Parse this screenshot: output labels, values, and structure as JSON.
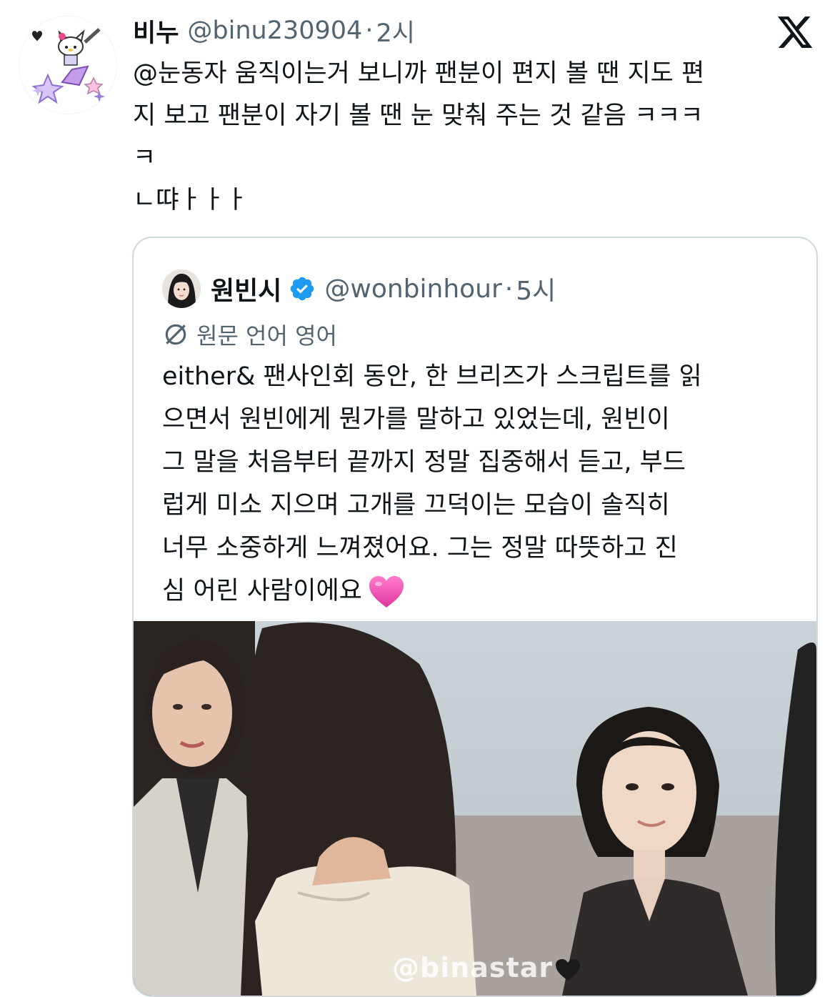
{
  "tweet": {
    "display_name": "비누",
    "handle": "@binu230904",
    "separator": "·",
    "time": "2시",
    "text_lines": [
      "@눈동자 움직이는거 보니까 팬분이 편지 볼 땐 지도 편",
      "지 보고 팬분이 자기 볼 땐 눈 맞춰 주는 것 같음 ㅋㅋㅋ",
      "ㅋ",
      "ㄴ땨ㅏㅏㅏ"
    ]
  },
  "quote": {
    "display_name": "원빈시",
    "handle": "@wonbinhour",
    "separator": "·",
    "time": "5시",
    "translate_label": "원문 언어 영어",
    "text_lines": [
      "either& 팬사인회 동안, 한 브리즈가 스크립트를 읽",
      "으면서 원빈에게 뭔가를 말하고 있었는데, 원빈이",
      "그 말을 처음부터 끝까지 정말 집중해서 듣고, 부드",
      "럽게 미소 지으며 고개를 끄덕이는 모습이 솔직히",
      "너무 소중하게 느껴졌어요. 그는 정말 따뜻하고 진",
      "심 어린 사람이에요"
    ],
    "media": {
      "watermark": "@binastar"
    }
  },
  "colors": {
    "text_primary": "#0f1419",
    "text_secondary": "#536471",
    "card_border": "#cfd9de",
    "verified_blue": "#1d9bf0",
    "heart_pink": "#f04fb4"
  },
  "icons": {
    "logo": "x-logo-icon",
    "verified": "verified-badge-icon",
    "translate": "translate-icon",
    "heart": "pink-heart-icon"
  }
}
